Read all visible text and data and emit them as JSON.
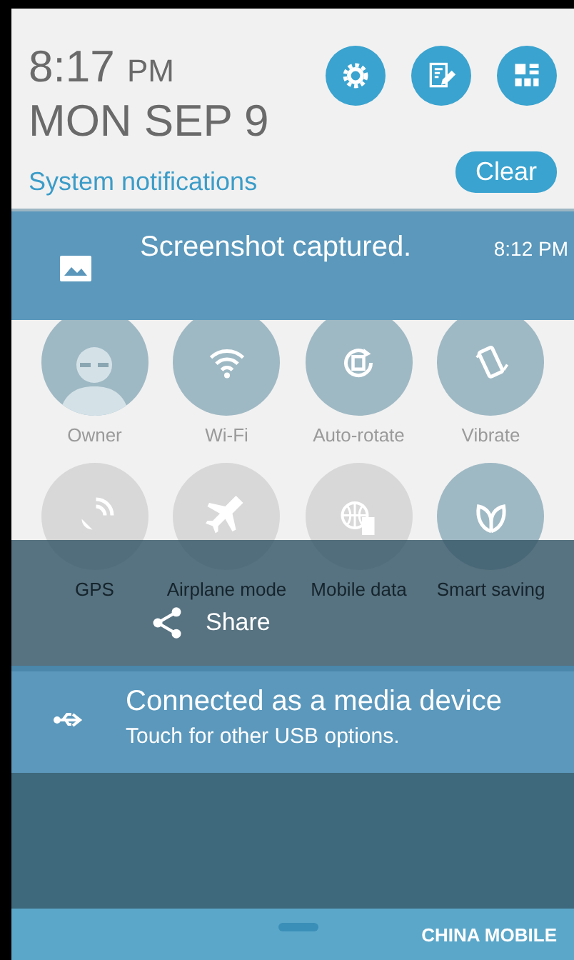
{
  "header": {
    "time": "8:17",
    "meridiem": "PM",
    "date": "MON SEP 9",
    "link": "System notifications",
    "clear_button": "Clear"
  },
  "notifications": [
    {
      "kind": "image",
      "title": "Screenshot captured.",
      "time": "8:12 PM"
    },
    {
      "kind": "usb",
      "title": "Connected as a media device",
      "subtitle": "Touch for other USB options."
    }
  ],
  "quick_settings": [
    {
      "label": "Owner",
      "on": true
    },
    {
      "label": "Wi-Fi",
      "on": true
    },
    {
      "label": "Auto-rotate",
      "on": true
    },
    {
      "label": "Vibrate",
      "on": true
    },
    {
      "label": "GPS",
      "on": false
    },
    {
      "label": "Airplane mode",
      "on": false
    },
    {
      "label": "Mobile data",
      "on": false
    },
    {
      "label": "Smart saving",
      "on": true
    }
  ],
  "share_bar": {
    "label": "Share"
  },
  "status_bar": {
    "carrier": "CHINA MOBILE"
  }
}
